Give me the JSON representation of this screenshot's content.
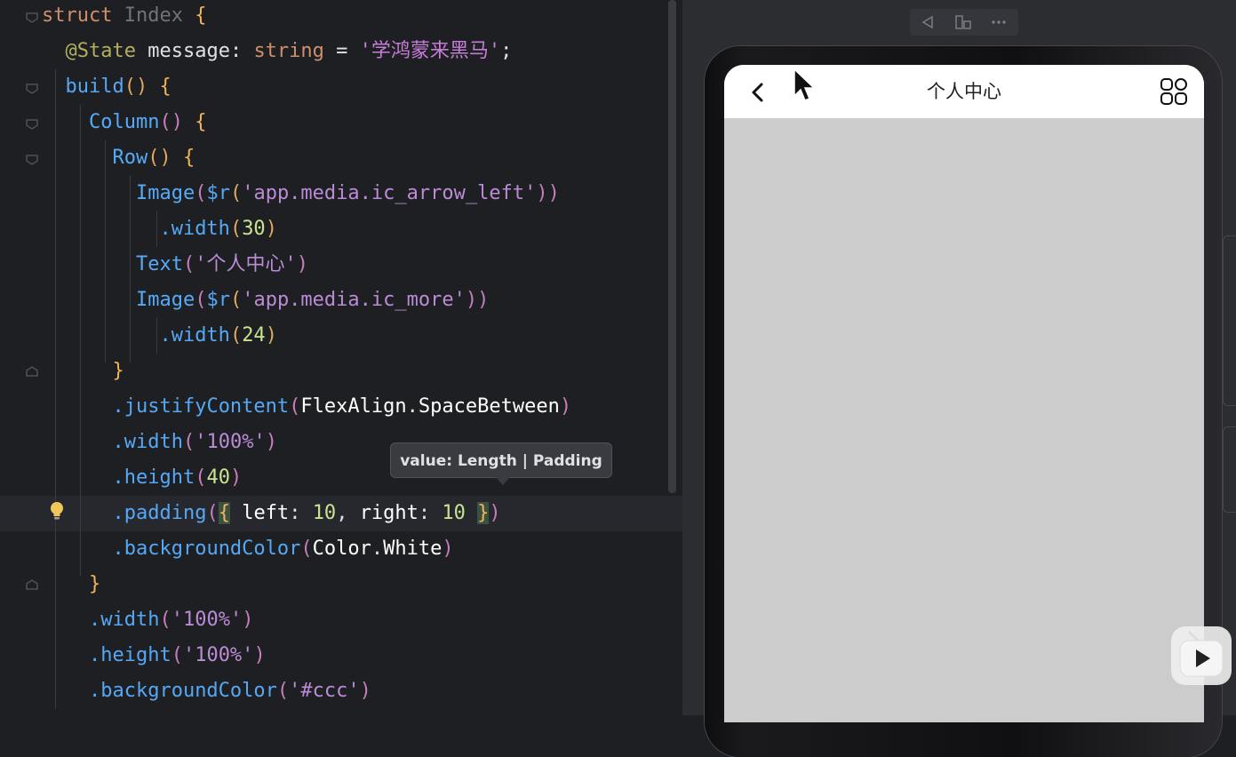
{
  "editor": {
    "lines": [
      [
        {
          "t": "struct ",
          "c": "kw"
        },
        {
          "t": "Index ",
          "c": "cls"
        },
        {
          "t": "{",
          "c": "brk"
        }
      ],
      [
        {
          "t": "  "
        },
        {
          "t": "@State ",
          "c": "ann"
        },
        {
          "t": "message",
          "c": "plain"
        },
        {
          "t": ": ",
          "c": "plain"
        },
        {
          "t": "string",
          "c": "kw"
        },
        {
          "t": " = ",
          "c": "plain"
        },
        {
          "t": "'学鸿蒙来黑马'",
          "c": "str"
        },
        {
          "t": ";",
          "c": "plain"
        }
      ],
      [
        {
          "t": "  "
        },
        {
          "t": "build",
          "c": "fnc"
        },
        {
          "t": "()",
          "c": "par"
        },
        {
          "t": " "
        },
        {
          "t": "{",
          "c": "brk"
        }
      ],
      [
        {
          "t": "    "
        },
        {
          "t": "Column",
          "c": "fn"
        },
        {
          "t": "()",
          "c": "par2"
        },
        {
          "t": " "
        },
        {
          "t": "{",
          "c": "brk"
        }
      ],
      [
        {
          "t": "      "
        },
        {
          "t": "Row",
          "c": "fn"
        },
        {
          "t": "()",
          "c": "par"
        },
        {
          "t": " "
        },
        {
          "t": "{",
          "c": "brk"
        }
      ],
      [
        {
          "t": "        "
        },
        {
          "t": "Image",
          "c": "fn"
        },
        {
          "t": "(",
          "c": "par2"
        },
        {
          "t": "$r",
          "c": "fnc"
        },
        {
          "t": "(",
          "c": "par"
        },
        {
          "t": "'app.media.ic_arrow_left'",
          "c": "str2"
        },
        {
          "t": "))",
          "c": "par2"
        }
      ],
      [
        {
          "t": "          "
        },
        {
          "t": ".width",
          "c": "fnc"
        },
        {
          "t": "(",
          "c": "par"
        },
        {
          "t": "30",
          "c": "num2"
        },
        {
          "t": ")",
          "c": "par"
        }
      ],
      [
        {
          "t": "        "
        },
        {
          "t": "Text",
          "c": "fn"
        },
        {
          "t": "(",
          "c": "par2"
        },
        {
          "t": "'个人中心'",
          "c": "str2"
        },
        {
          "t": ")",
          "c": "par2"
        }
      ],
      [
        {
          "t": "        "
        },
        {
          "t": "Image",
          "c": "fn"
        },
        {
          "t": "(",
          "c": "par2"
        },
        {
          "t": "$r",
          "c": "fnc"
        },
        {
          "t": "(",
          "c": "par"
        },
        {
          "t": "'app.media.ic_more'",
          "c": "str2"
        },
        {
          "t": "))",
          "c": "par2"
        }
      ],
      [
        {
          "t": "          "
        },
        {
          "t": ".width",
          "c": "fnc"
        },
        {
          "t": "(",
          "c": "par"
        },
        {
          "t": "24",
          "c": "num2"
        },
        {
          "t": ")",
          "c": "par"
        }
      ],
      [
        {
          "t": "      "
        },
        {
          "t": "}",
          "c": "brk"
        }
      ],
      [
        {
          "t": "      "
        },
        {
          "t": ".justifyContent",
          "c": "fnc"
        },
        {
          "t": "(",
          "c": "par2"
        },
        {
          "t": "FlexAlign",
          "c": "white"
        },
        {
          "t": ".",
          "c": "plain"
        },
        {
          "t": "SpaceBetween",
          "c": "white"
        },
        {
          "t": ")",
          "c": "par2"
        }
      ],
      [
        {
          "t": "      "
        },
        {
          "t": ".width",
          "c": "fnc"
        },
        {
          "t": "(",
          "c": "par2"
        },
        {
          "t": "'100%'",
          "c": "str2"
        },
        {
          "t": ")",
          "c": "par2"
        }
      ],
      [
        {
          "t": "      "
        },
        {
          "t": ".height",
          "c": "fnc"
        },
        {
          "t": "(",
          "c": "par2"
        },
        {
          "t": "40",
          "c": "num2"
        },
        {
          "t": ")",
          "c": "par2"
        }
      ],
      [
        {
          "t": "      "
        },
        {
          "t": ".padding",
          "c": "fnc"
        },
        {
          "t": "(",
          "c": "par2"
        },
        {
          "t": "{",
          "c": "brk hl"
        },
        {
          "t": " left",
          "c": "white"
        },
        {
          "t": ": ",
          "c": "plain"
        },
        {
          "t": "10",
          "c": "num2"
        },
        {
          "t": ", ",
          "c": "plain"
        },
        {
          "t": "right",
          "c": "white"
        },
        {
          "t": ": ",
          "c": "plain"
        },
        {
          "t": "10",
          "c": "num2"
        },
        {
          "t": " "
        },
        {
          "t": "}",
          "c": "brk hl"
        },
        {
          "t": ")",
          "c": "par2"
        }
      ],
      [
        {
          "t": "      "
        },
        {
          "t": ".backgroundColor",
          "c": "fnc"
        },
        {
          "t": "(",
          "c": "par2"
        },
        {
          "t": "Color",
          "c": "white"
        },
        {
          "t": ".",
          "c": "plain"
        },
        {
          "t": "White",
          "c": "white"
        },
        {
          "t": ")",
          "c": "par2"
        }
      ],
      [
        {
          "t": "    "
        },
        {
          "t": "}",
          "c": "brk"
        }
      ],
      [
        {
          "t": "    "
        },
        {
          "t": ".width",
          "c": "fnc"
        },
        {
          "t": "(",
          "c": "par2"
        },
        {
          "t": "'100%'",
          "c": "str2"
        },
        {
          "t": ")",
          "c": "par2"
        }
      ],
      [
        {
          "t": "    "
        },
        {
          "t": ".height",
          "c": "fnc"
        },
        {
          "t": "(",
          "c": "par2"
        },
        {
          "t": "'100%'",
          "c": "str2"
        },
        {
          "t": ")",
          "c": "par2"
        }
      ],
      [
        {
          "t": "    "
        },
        {
          "t": ".backgroundColor",
          "c": "fnc"
        },
        {
          "t": "(",
          "c": "par2"
        },
        {
          "t": "'#ccc'",
          "c": "str2"
        },
        {
          "t": ")",
          "c": "par2"
        }
      ]
    ],
    "tooltip": "value: Length | Padding"
  },
  "preview": {
    "toolbar": [
      "back-triangle-icon",
      "layout-icon",
      "more-dots-icon"
    ],
    "page_title": "个人中心",
    "background": "#cccccc"
  }
}
